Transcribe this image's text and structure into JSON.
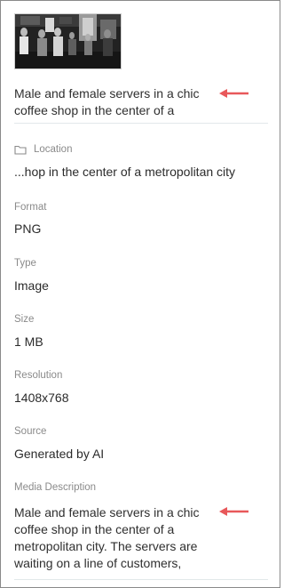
{
  "media": {
    "thumbnail_alt": "Male and female servers in a chic coffee shop in the center of a metropolitan city",
    "caption": "Male and female servers in a chic coffee shop in the center of a"
  },
  "details": {
    "location_label": "Location",
    "location_value": "...hop in the center of a metropolitan city",
    "format_label": "Format",
    "format_value": "PNG",
    "type_label": "Type",
    "type_value": "Image",
    "size_label": "Size",
    "size_value": "1 MB",
    "resolution_label": "Resolution",
    "resolution_value": "1408x768",
    "source_label": "Source",
    "source_value": "Generated by AI",
    "description_label": "Media Description",
    "description_value": "Male and female servers in a chic coffee shop in the center of a metropolitan city. The servers are waiting on a line of customers,"
  },
  "icons": {
    "location": "folder-icon",
    "annotation": "red-arrow-icon"
  },
  "colors": {
    "annotation_arrow": "#e8585a",
    "label": "#8a8a8a",
    "text": "#2b2b2b",
    "border": "#8a8a8a"
  }
}
